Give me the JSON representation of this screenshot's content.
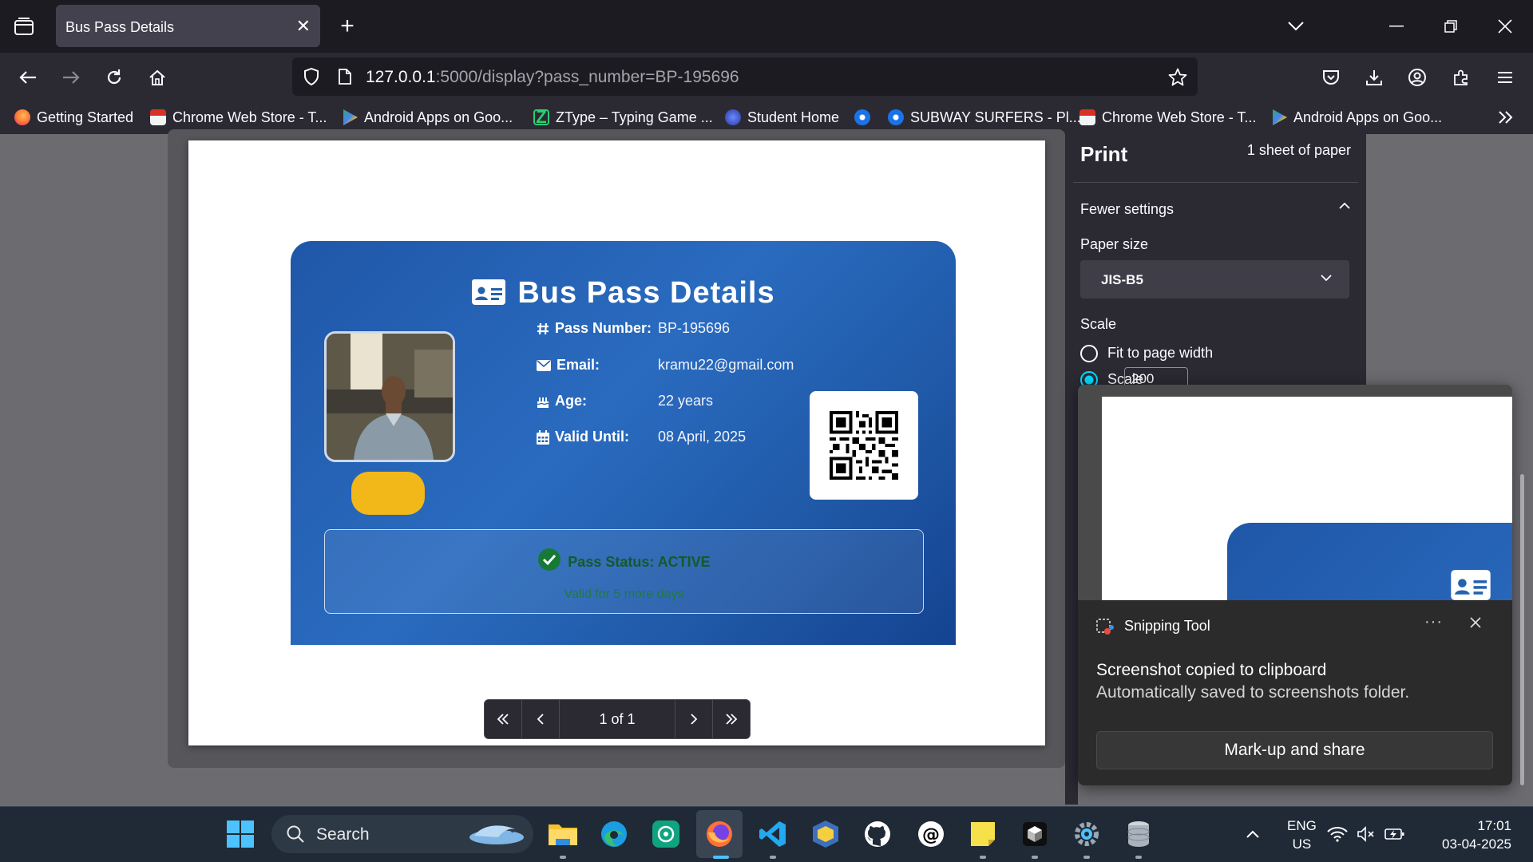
{
  "browser": {
    "tab_title": "Bus Pass Details",
    "url_host": "127.0.0.1",
    "url_rest": ":5000/display?pass_number=BP-195696",
    "bookmarks": [
      {
        "label": "Getting Started",
        "color": "#ff7139"
      },
      {
        "label": "Chrome Web Store - T...",
        "color": "#d93025"
      },
      {
        "label": "Android Apps on Goo...",
        "color": "#34a853"
      },
      {
        "label": "ZType – Typing Game ...",
        "color": "#2ecc71"
      },
      {
        "label": "Student Home",
        "color": "#3b5bdb"
      },
      {
        "label": "",
        "color": "#1a73e8"
      },
      {
        "label": "SUBWAY SURFERS - Pl...",
        "color": "#1a73e8"
      },
      {
        "label": "Chrome Web Store - T...",
        "color": "#d93025"
      },
      {
        "label": "Android Apps on Goo...",
        "color": "#34a853"
      }
    ]
  },
  "card": {
    "title": "Bus Pass Details",
    "rows": [
      {
        "label": "Pass Number:",
        "value": "BP-195696",
        "icon": "hash-icon"
      },
      {
        "label": "Email:",
        "value": "kramu22@gmail.com",
        "icon": "envelope-icon"
      },
      {
        "label": "Age:",
        "value": "22 years",
        "icon": "birthday-cake-icon"
      },
      {
        "label": "Valid Until:",
        "value": "08 April, 2025",
        "icon": "calendar-icon"
      }
    ],
    "status": "Pass Status: ACTIVE",
    "status_sub": "Valid for 5 more days",
    "accent": "#2a6bbf"
  },
  "pager": {
    "text": "1 of 1"
  },
  "print": {
    "title": "Print",
    "sheets": "1 sheet of paper",
    "fewer_settings": "Fewer settings",
    "paper_size_label": "Paper size",
    "paper_size_value": "JIS-B5",
    "scale_label": "Scale",
    "fit_label": "Fit to page width",
    "scale_option_label": "Scale",
    "scale_value": "200"
  },
  "notification": {
    "app": "Snipping Tool",
    "dots": "···",
    "headline": "Screenshot copied to clipboard",
    "sub": "Automatically saved to screenshots folder.",
    "button": "Mark-up and share"
  },
  "taskbar": {
    "search": "Search",
    "lang_1": "ENG",
    "lang_2": "US",
    "time": "17:01",
    "date": "03-04-2025"
  }
}
